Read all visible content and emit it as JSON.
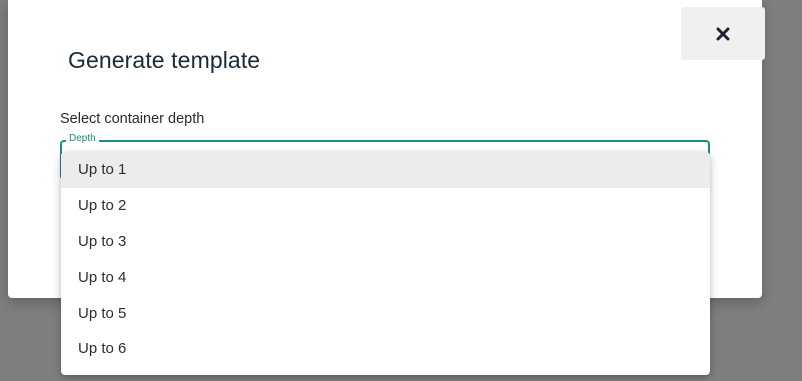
{
  "dialog": {
    "title": "Generate template",
    "close_icon": "close-icon",
    "field_label": "Select container depth",
    "depth_legend": "Depth"
  },
  "dropdown": {
    "selected_index": 0,
    "options": [
      {
        "label": "Up to 1"
      },
      {
        "label": "Up to 2"
      },
      {
        "label": "Up to 3"
      },
      {
        "label": "Up to 4"
      },
      {
        "label": "Up to 5"
      },
      {
        "label": "Up to 6"
      }
    ]
  },
  "colors": {
    "accent": "#1f8a86",
    "backdrop": "#7f7f7f",
    "selected_option_bg": "#ececec"
  }
}
